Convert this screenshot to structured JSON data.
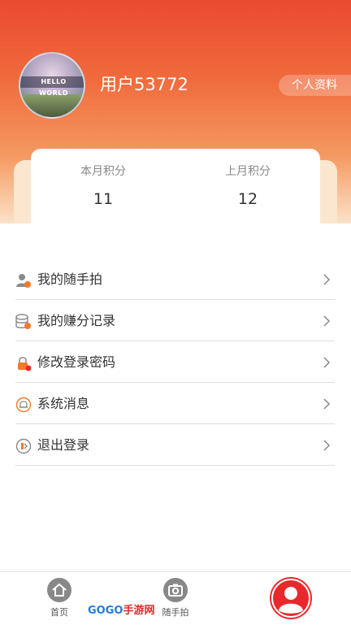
{
  "profile": {
    "username": "用户53772",
    "profile_button": "个人资料",
    "avatar_text": "HELLO WORLD"
  },
  "points": {
    "this_month_label": "本月积分",
    "this_month_value": "11",
    "last_month_label": "上月积分",
    "last_month_value": "12"
  },
  "menu": {
    "items": [
      {
        "label": "我的随手拍",
        "icon": "user-photo-icon"
      },
      {
        "label": "我的赚分记录",
        "icon": "database-coin-icon"
      },
      {
        "label": "修改登录密码",
        "icon": "lock-icon"
      },
      {
        "label": "系统消息",
        "icon": "bell-icon"
      },
      {
        "label": "退出登录",
        "icon": "logout-icon"
      }
    ]
  },
  "tabbar": {
    "home_label": "首页",
    "camera_label": "随手拍",
    "watermark_gogo": "GOGO",
    "watermark_cn": "手游网"
  },
  "colors": {
    "accent": "#e8282a",
    "header_top": "#ea4a30",
    "icon_orange": "#f07a2a"
  }
}
